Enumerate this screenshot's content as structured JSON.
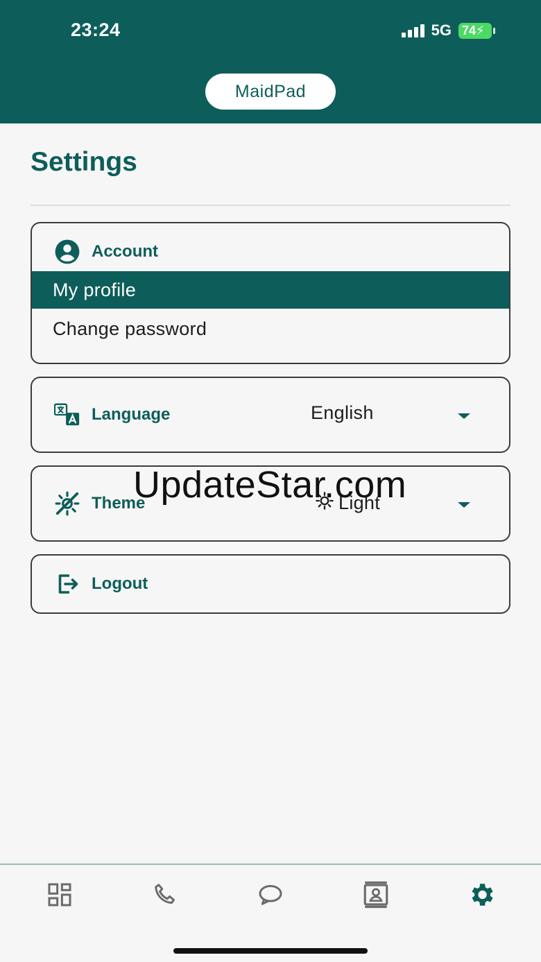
{
  "status_bar": {
    "time": "23:24",
    "network": "5G",
    "battery": "74"
  },
  "header": {
    "app_name": "MaidPad"
  },
  "page": {
    "title": "Settings"
  },
  "account": {
    "heading": "Account",
    "items": [
      {
        "label": "My profile",
        "active": true
      },
      {
        "label": "Change password",
        "active": false
      }
    ]
  },
  "language": {
    "heading": "Language",
    "value": "English"
  },
  "theme": {
    "heading": "Theme",
    "value": "Light"
  },
  "logout": {
    "label": "Logout"
  },
  "watermark": "UpdateStar.com",
  "bottom_nav": {
    "items": [
      {
        "icon": "dashboard-icon",
        "active": false
      },
      {
        "icon": "phone-icon",
        "active": false
      },
      {
        "icon": "chat-icon",
        "active": false
      },
      {
        "icon": "contact-card-icon",
        "active": false
      },
      {
        "icon": "gear-icon",
        "active": true
      }
    ]
  },
  "colors": {
    "primary": "#0d5e5a",
    "background": "#f6f6f6",
    "battery": "#4cd964",
    "inactive_icon": "#6b6b6b"
  }
}
